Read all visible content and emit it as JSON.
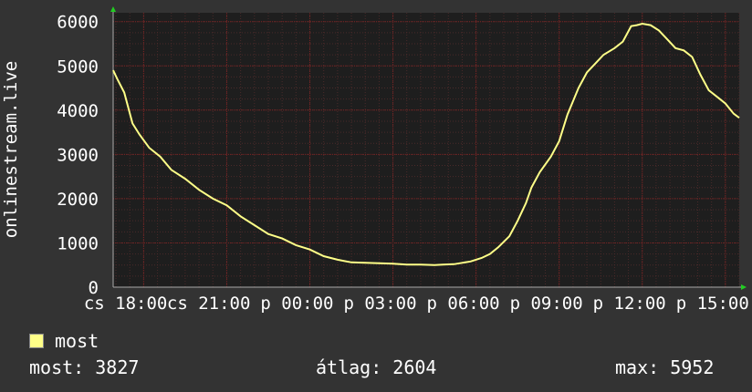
{
  "chart_data": {
    "type": "line",
    "ylabel": "onlinestream.live",
    "ylim": [
      0,
      6200
    ],
    "grid": true,
    "y_ticks": [
      "0",
      "1000",
      "2000",
      "3000",
      "4000",
      "5000",
      "6000"
    ],
    "x_ticks": [
      "cs 18:00",
      "cs 21:00",
      "p 00:00",
      "p 03:00",
      "p 06:00",
      "p 09:00",
      "p 12:00",
      "p 15:00"
    ],
    "x_range_hours": [
      16.9,
      39.5
    ],
    "series": [
      {
        "name": "most",
        "color": "#ffff88",
        "x": [
          16.9,
          17.05,
          17.3,
          17.6,
          17.85,
          18.2,
          18.6,
          19.0,
          19.5,
          20.0,
          20.5,
          21.0,
          21.5,
          22.0,
          22.5,
          23.0,
          23.5,
          24.0,
          24.5,
          25.0,
          25.5,
          26.0,
          26.5,
          27.0,
          27.5,
          28.0,
          28.5,
          28.8,
          29.2,
          29.5,
          29.8,
          30.2,
          30.5,
          30.8,
          31.2,
          31.5,
          31.8,
          32.0,
          32.3,
          32.7,
          33.0,
          33.3,
          33.7,
          34.0,
          34.3,
          34.6,
          35.0,
          35.3,
          35.6,
          35.8,
          36.0,
          36.3,
          36.6,
          36.9,
          37.2,
          37.5,
          37.8,
          38.1,
          38.4,
          38.7,
          39.0,
          39.3,
          39.5
        ],
        "values": [
          4900,
          4700,
          4400,
          3700,
          3450,
          3150,
          2950,
          2650,
          2450,
          2200,
          2000,
          1850,
          1600,
          1400,
          1200,
          1100,
          950,
          850,
          700,
          620,
          560,
          550,
          540,
          530,
          510,
          510,
          500,
          510,
          520,
          550,
          580,
          660,
          750,
          900,
          1150,
          1500,
          1900,
          2250,
          2600,
          2950,
          3300,
          3900,
          4500,
          4850,
          5050,
          5250,
          5400,
          5550,
          5900,
          5920,
          5952,
          5920,
          5800,
          5600,
          5400,
          5350,
          5200,
          4800,
          4450,
          4300,
          4150,
          3920,
          3827
        ]
      }
    ]
  },
  "legend": {
    "label": "most",
    "color": "#ffff88"
  },
  "stats": {
    "current": "most: 3827",
    "average": "átlag: 2604",
    "max": "max: 5952"
  },
  "colors": {
    "background": "#333333",
    "plot_background": "#1e1e1e",
    "grid_minor": "#4a2a2a",
    "grid_major": "#7a2222",
    "axis_arrow": "#22cc22",
    "line": "#ffff88"
  }
}
